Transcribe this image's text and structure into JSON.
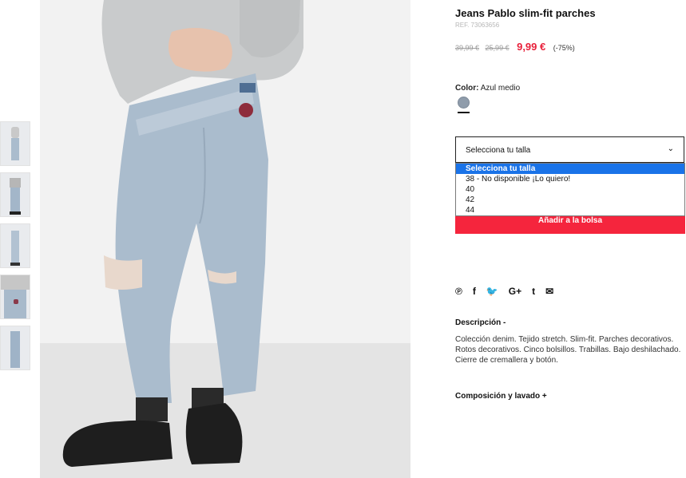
{
  "product": {
    "title": "Jeans Pablo slim-fit parches",
    "ref": "REF. 73063656",
    "price_old_1": "39,99 €",
    "price_old_2": "25,99 €",
    "price_current": "9,99 €",
    "discount": "(-75%)"
  },
  "color": {
    "label": "Color:",
    "value": "Azul medio",
    "swatch": "#8f9cab"
  },
  "size_select": {
    "label": "Selecciona tu talla",
    "options": [
      "Selecciona tu talla",
      "38 - No disponible ¡Lo quiero!",
      "40",
      "42",
      "44"
    ]
  },
  "cart": {
    "add_label": "Añadir a la bolsa"
  },
  "share": {
    "icons": [
      "pinterest-icon",
      "facebook-icon",
      "twitter-icon",
      "google-plus-icon",
      "tumblr-icon",
      "email-icon"
    ],
    "glyphs": [
      "℗",
      "f",
      "🐦",
      "G+",
      "t",
      "✉"
    ]
  },
  "description": {
    "heading": "Descripción -",
    "text": "Colección denim. Tejido stretch. Slim-fit. Parches decorativos. Rotos decorativos. Cinco bolsillos. Trabillas. Bajo deshilachado. Cierre de cremallera y botón."
  },
  "composition": {
    "heading": "Composición y lavado +"
  },
  "colors": {
    "accent_red": "#f5253d",
    "price_red": "#e8203a",
    "select_highlight": "#1a73e8",
    "denim": "#aabccd"
  }
}
